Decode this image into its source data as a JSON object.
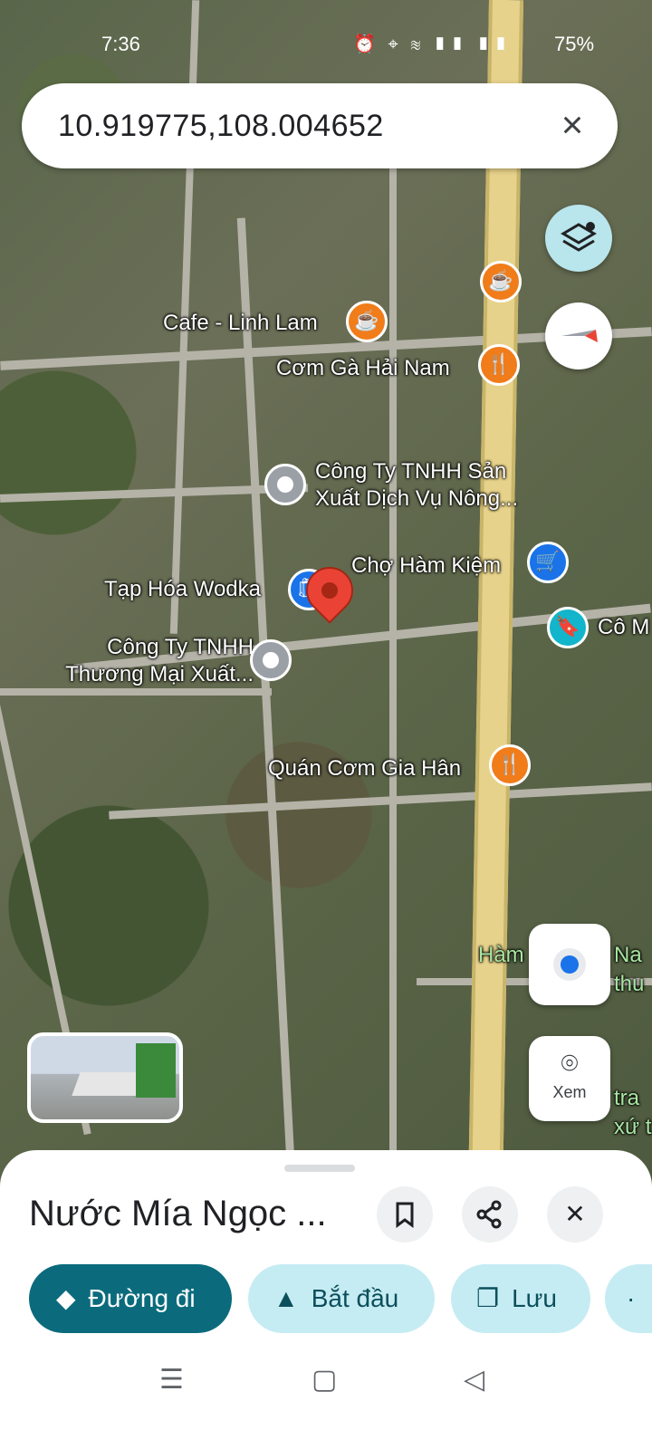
{
  "status_bar": {
    "time": "7:36",
    "icons": "⏰ ⌖ ≋ ▮▮ ▮▮",
    "battery": "75%"
  },
  "search": {
    "query": "10.919775,108.004652",
    "clear_icon": "close-icon"
  },
  "map": {
    "pois": [
      {
        "name": "Cafe - Linh Lam",
        "icon": "cafe-icon"
      },
      {
        "name": "Cơm Gà Hải Nam",
        "icon": "restaurant-icon"
      },
      {
        "name": "Công Ty TNHH Sản Xuất Dịch Vụ Nông...",
        "icon": "place-icon"
      },
      {
        "name": "Chợ Hàm Kiệm",
        "icon": "shopping-cart-icon"
      },
      {
        "name": "Tạp Hóa Wodka",
        "icon": "shopping-bag-icon"
      },
      {
        "name": "Cô M",
        "icon": "bookmark-icon"
      },
      {
        "name": "Công Ty TNHH Thương Mại Xuất...",
        "icon": "place-icon"
      },
      {
        "name": "Quán Cơm Gia Hân",
        "icon": "restaurant-icon"
      },
      {
        "name": "Hàm",
        "icon": ""
      },
      {
        "name": "Na",
        "icon": ""
      },
      {
        "name": "thu",
        "icon": ""
      },
      {
        "name": "tra",
        "icon": ""
      },
      {
        "name": "xứ t",
        "icon": ""
      }
    ]
  },
  "controls": {
    "lens_label": "Xem"
  },
  "sheet": {
    "title": "Nước Mía Ngọc ...",
    "actions": {
      "directions": "Đường đi",
      "start": "Bắt đầu",
      "save": "Lưu"
    }
  }
}
